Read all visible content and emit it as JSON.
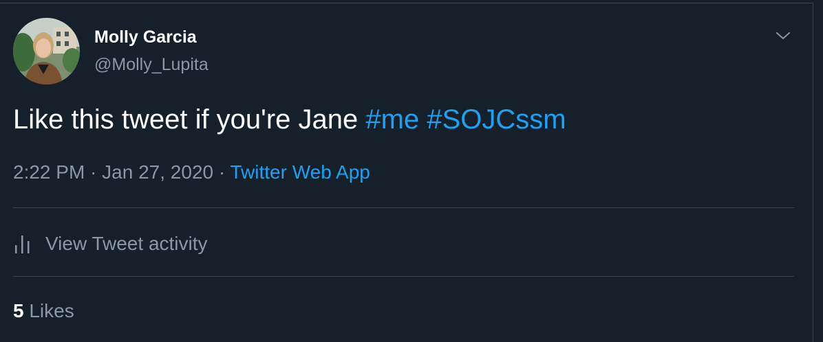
{
  "author": {
    "name": "Molly Garcia",
    "handle": "@Molly_Lupita"
  },
  "tweet": {
    "text": "Like this tweet if you're Jane ",
    "hashtags": [
      "#me",
      "#SOJCssm"
    ],
    "time": "2:22 PM",
    "date": "Jan 27, 2020",
    "separator": " · ",
    "source": "Twitter Web App"
  },
  "activity": {
    "label": "View Tweet activity",
    "icon": "bar-chart-icon"
  },
  "likes": {
    "count": "5",
    "label": "Likes"
  },
  "menu": {
    "icon": "chevron-down-icon"
  },
  "colors": {
    "background": "#15202b",
    "accent": "#1da1f2",
    "secondary_text": "#8899a6",
    "border": "#38444d"
  }
}
